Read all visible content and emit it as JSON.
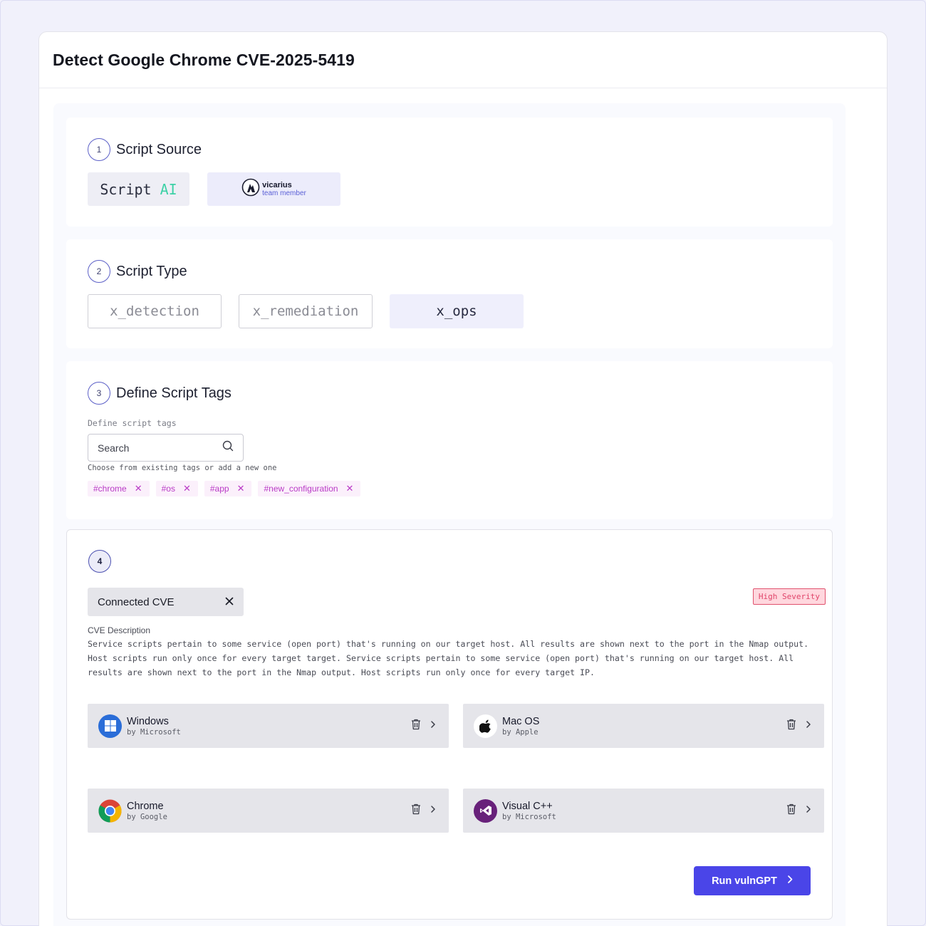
{
  "header": {
    "title": "Detect Google Chrome CVE-2025-5419"
  },
  "sections": {
    "source": {
      "number": "1",
      "title": "Script Source",
      "script_ai": {
        "word": "Script",
        "ai": "AI"
      },
      "vicarius": {
        "name": "vicarius",
        "sub": "team member"
      }
    },
    "type": {
      "number": "2",
      "title": "Script Type",
      "options": [
        "x_detection",
        "x_remediation",
        "x_ops"
      ],
      "selected": "x_ops"
    },
    "tags": {
      "number": "3",
      "title": "Define Script Tags",
      "field_label": "Define script tags",
      "search_placeholder": "Search",
      "helper": "Choose from existing tags or add a new one",
      "items": [
        "#chrome",
        "#os",
        "#app",
        "#new_configuration"
      ],
      "tag_color": "#b93ac6"
    },
    "cve": {
      "number": "4",
      "chip_label": "Connected CVE",
      "severity": "High Severity",
      "severity_color": "#e0446a",
      "description_label": "CVE Description",
      "description": "Service scripts pertain to some service (open port) that's running on our target host. All results are shown next to the port in the Nmap output. Host scripts run only once for every target target. Service scripts pertain to some service (open port) that's running on our target host. All results are shown next to the port in the Nmap output. Host scripts run only once for every target IP.",
      "products": [
        {
          "name": "Windows",
          "vendor": "by Microsoft",
          "icon": "windows-icon"
        },
        {
          "name": "Mac OS",
          "vendor": "by Apple",
          "icon": "apple-icon"
        },
        {
          "name": "Chrome",
          "vendor": "by Google",
          "icon": "chrome-icon"
        },
        {
          "name": "Visual C++",
          "vendor": "by Microsoft",
          "icon": "visual-studio-icon"
        }
      ],
      "run_label": "Run vulnGPT",
      "accent_color": "#4a45e8"
    }
  }
}
